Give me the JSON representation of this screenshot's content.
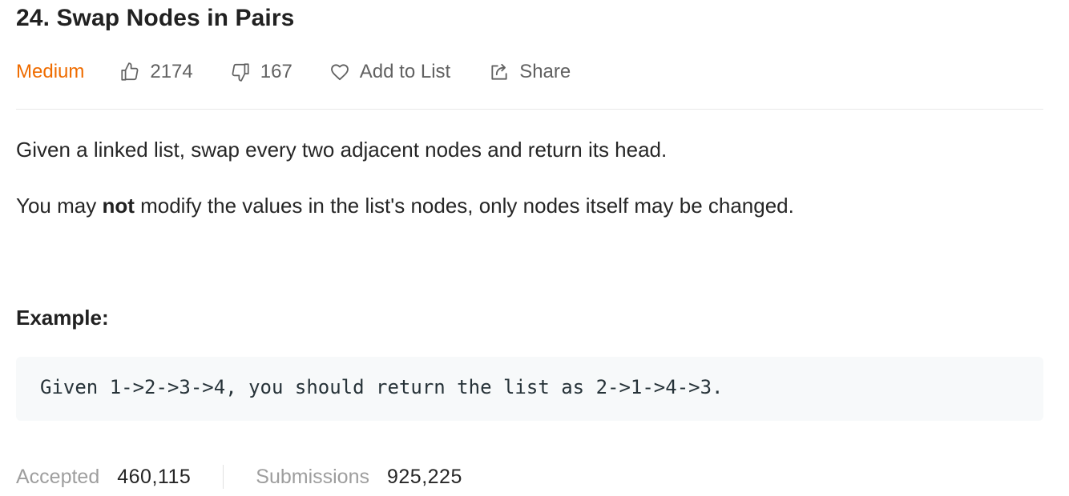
{
  "problem": {
    "title": "24. Swap Nodes in Pairs",
    "difficulty": "Medium",
    "likes": "2174",
    "dislikes": "167",
    "add_to_list_label": "Add to List",
    "share_label": "Share"
  },
  "description": {
    "paragraph1": "Given a linked list, swap every two adjacent nodes and return its head.",
    "paragraph2_before": "You may ",
    "paragraph2_bold": "not",
    "paragraph2_after": " modify the values in the list's nodes, only nodes itself may be changed."
  },
  "example": {
    "label": "Example:",
    "code": "Given 1->2->3->4, you should return the list as 2->1->4->3."
  },
  "stats": {
    "accepted_label": "Accepted",
    "accepted_value": "460,115",
    "submissions_label": "Submissions",
    "submissions_value": "925,225"
  },
  "icons": {
    "like": "thumbs-up-icon",
    "dislike": "thumbs-down-icon",
    "add_to_list": "heart-icon",
    "share": "share-icon"
  },
  "colors": {
    "difficulty_medium": "#ef6c00",
    "meta_text": "#616161",
    "code_background": "#f7f9fa",
    "stat_label": "#9e9e9e"
  }
}
